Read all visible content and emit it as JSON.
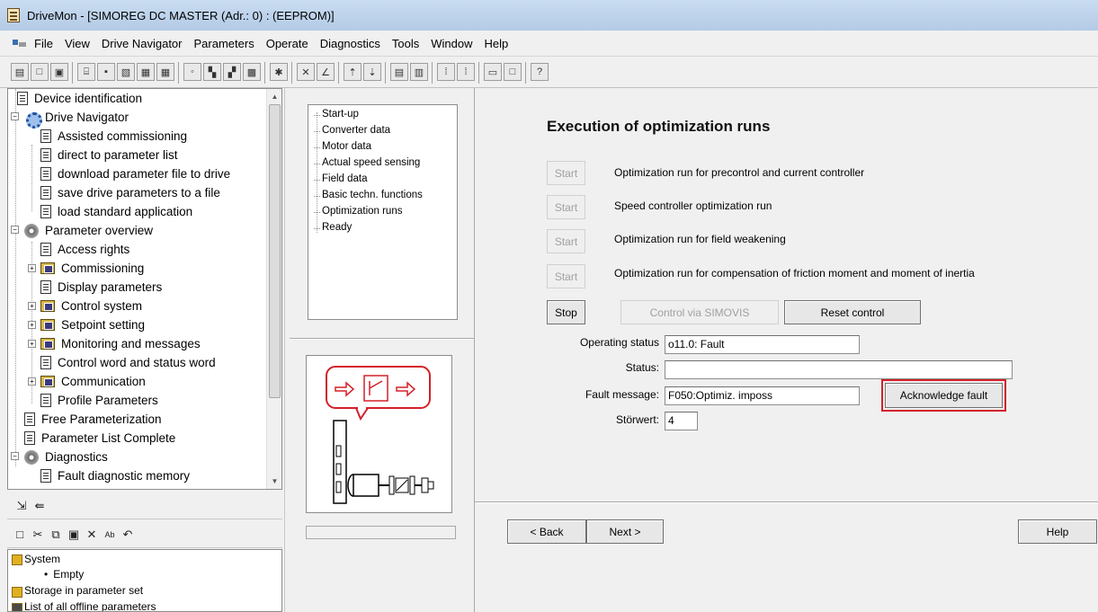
{
  "window": {
    "title": "DriveMon - [SIMOREG DC MASTER  (Adr.: 0) : (EEPROM)]"
  },
  "menu": [
    "File",
    "View",
    "Drive Navigator",
    "Parameters",
    "Operate",
    "Diagnostics",
    "Tools",
    "Window",
    "Help"
  ],
  "tree": [
    {
      "label": "Device identification",
      "icon": "document-icon"
    },
    {
      "label": "Drive Navigator",
      "icon": "navigator-icon"
    },
    {
      "label": "Assisted commissioning",
      "icon": "document-icon"
    },
    {
      "label": "direct to parameter list",
      "icon": "document-icon"
    },
    {
      "label": "download parameter file to drive",
      "icon": "document-icon"
    },
    {
      "label": "save drive parameters to a file",
      "icon": "document-icon"
    },
    {
      "label": "load standard application",
      "icon": "document-icon"
    },
    {
      "label": "Parameter overview",
      "icon": "gear-icon"
    },
    {
      "label": "Access rights",
      "icon": "document-icon"
    },
    {
      "label": "Commissioning",
      "icon": "folder-icon"
    },
    {
      "label": "Display parameters",
      "icon": "document-icon"
    },
    {
      "label": "Control system",
      "icon": "folder-icon"
    },
    {
      "label": "Setpoint setting",
      "icon": "folder-icon"
    },
    {
      "label": "Monitoring and messages",
      "icon": "folder-icon"
    },
    {
      "label": "Control word and status word",
      "icon": "document-icon"
    },
    {
      "label": "Communication",
      "icon": "folder-icon"
    },
    {
      "label": "Profile Parameters",
      "icon": "document-icon"
    },
    {
      "label": "Free Parameterization",
      "icon": "document-icon"
    },
    {
      "label": "Parameter List Complete",
      "icon": "document-icon"
    },
    {
      "label": "Diagnostics",
      "icon": "gear-icon"
    },
    {
      "label": "Fault diagnostic memory",
      "icon": "document-icon"
    }
  ],
  "storage": {
    "system": "System",
    "empty": "Empty",
    "storage_set": "Storage in parameter set",
    "offline": "List of all offline parameters"
  },
  "steps": [
    "Start-up",
    "Converter data",
    "Motor data",
    "Actual speed sensing",
    "Field data",
    "Basic techn. functions",
    "Optimization runs",
    "Ready"
  ],
  "main": {
    "title": "Execution of optimization runs",
    "start_label": "Start",
    "runs": [
      "Optimization run for precontrol and current controller",
      "Speed controller optimization run",
      "Optimization run for field weakening",
      "Optimization run for compensation of friction moment and moment of inertia"
    ],
    "stop_label": "Stop",
    "simovis_label": "Control via SIMOVIS",
    "reset_label": "Reset control",
    "operating_status_label": "Operating status",
    "operating_status_value": "o11.0: Fault",
    "status_label": "Status:",
    "status_value": "",
    "fault_message_label": "Fault message:",
    "fault_message_value": "F050:Optimiz. imposs",
    "ack_label": "Acknowledge fault",
    "stoerwert_label": "Störwert:",
    "stoerwert_value": "4",
    "back_label": "< Back",
    "next_label": "Next >",
    "help_label": "Help"
  },
  "colors": {
    "highlight": "#d3202a",
    "titlebar": "#b4cbe6"
  }
}
